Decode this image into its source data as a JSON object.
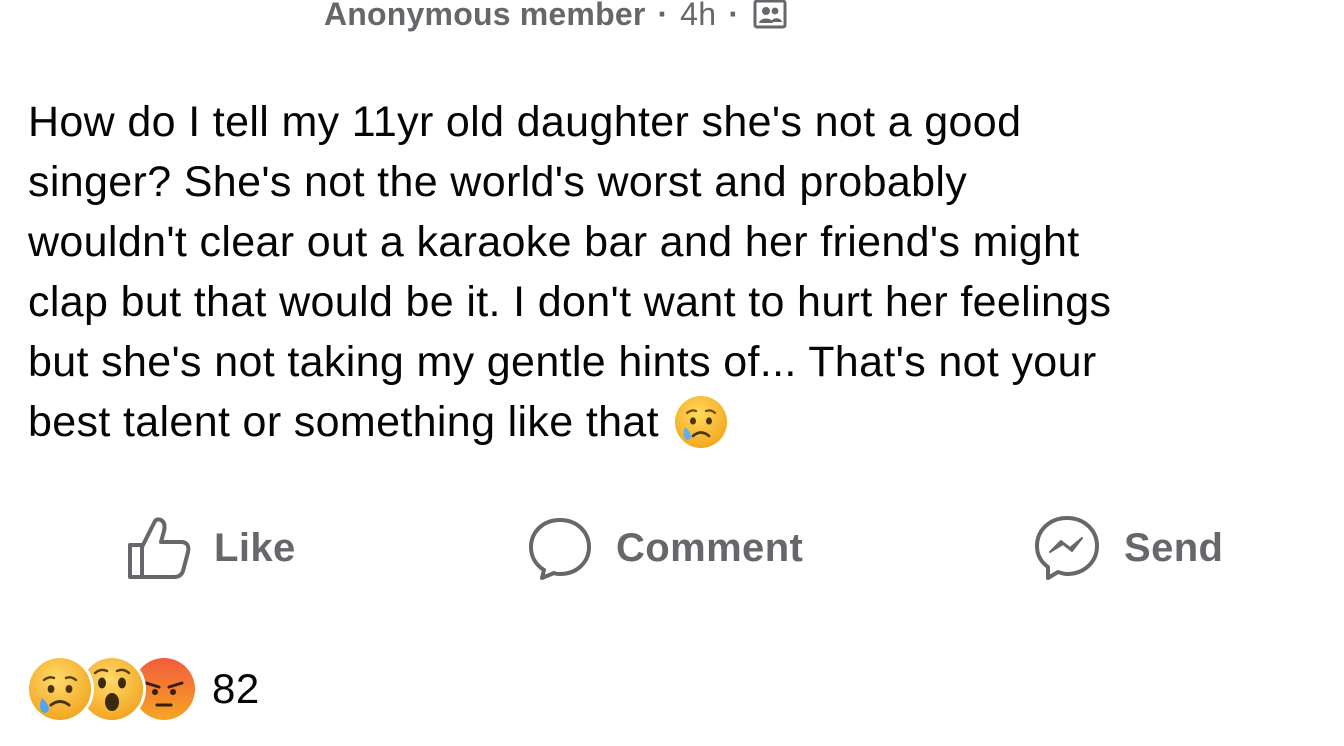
{
  "post": {
    "author": "Anonymous member",
    "separator": "·",
    "time": "4h",
    "audience_icon": "group-icon",
    "lines": [
      "How do I tell my 11yr old daughter she's not a good",
      "singer? She's not the world's worst and probably",
      "wouldn't clear out a karaoke bar and her friend's might",
      "clap but that would be it. I don't want to hurt her feelings",
      "but she's not taking my gentle hints of... That's not your",
      "best talent or something like that"
    ],
    "trailing_emoji": "sad-but-relieved-face-emoji"
  },
  "actions": {
    "like": {
      "label": "Like",
      "icon": "thumbs-up-icon"
    },
    "comment": {
      "label": "Comment",
      "icon": "comment-bubble-icon"
    },
    "send": {
      "label": "Send",
      "icon": "messenger-icon"
    }
  },
  "reactions": {
    "types": [
      "sad-reaction-icon",
      "wow-reaction-icon",
      "angry-reaction-icon"
    ],
    "count": "82"
  },
  "colors": {
    "text_primary": "#050505",
    "text_secondary": "#65676b",
    "emoji_yellow": "#f7b125",
    "angry_red": "#e9710f"
  }
}
